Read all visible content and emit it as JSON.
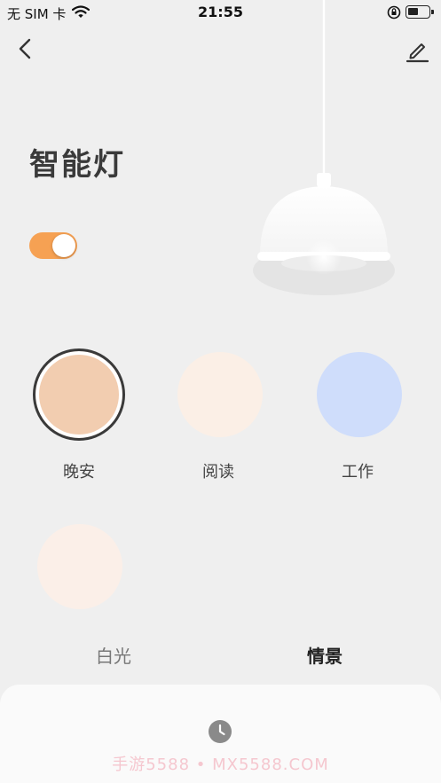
{
  "status_bar": {
    "carrier": "无 SIM 卡",
    "time": "21:55"
  },
  "header": {
    "back_icon": "chevron-left-icon",
    "edit_icon": "pencil-icon"
  },
  "device": {
    "title": "智能灯",
    "power_on": true,
    "accent_color": "#f6a153"
  },
  "scenes": [
    {
      "label": "晚安",
      "color": "#f2cdb0",
      "selected": true
    },
    {
      "label": "阅读",
      "color": "#fbefe6",
      "selected": false
    },
    {
      "label": "工作",
      "color": "#cfddfb",
      "selected": false
    },
    {
      "label": "",
      "color": "#fbefe8",
      "selected": false
    }
  ],
  "tabs": [
    {
      "label": "白光",
      "active": false
    },
    {
      "label": "情景",
      "active": true
    }
  ],
  "bottom": {
    "clock_icon": "clock-icon",
    "watermark": "手游5588 • MX5588.COM"
  }
}
